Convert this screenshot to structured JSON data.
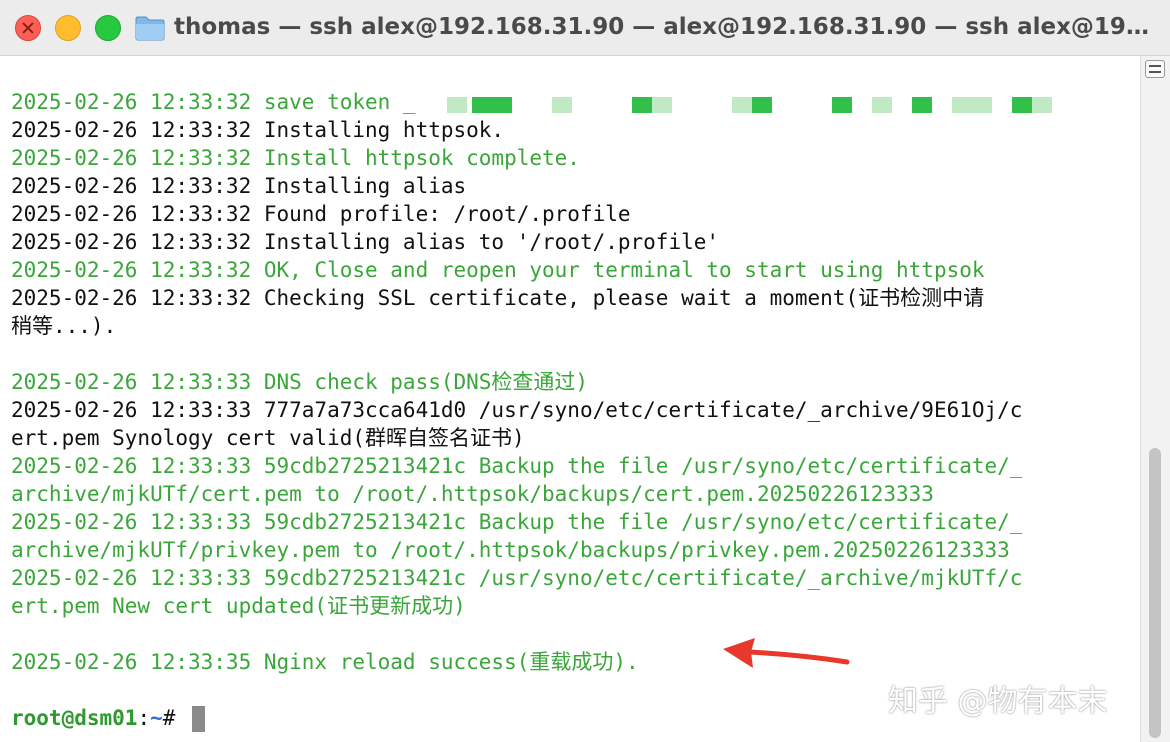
{
  "window": {
    "title": "thomas — ssh alex@192.168.31.90 — alex@192.168.31.90 — ssh alex@192.1..."
  },
  "terminal": {
    "lines": [
      {
        "text": "2025-02-26 12:33:32 save token _",
        "color": "green"
      },
      {
        "text": "2025-02-26 12:33:32 Installing httpsok.",
        "color": "black"
      },
      {
        "text": "2025-02-26 12:33:32 Install httpsok complete.",
        "color": "green"
      },
      {
        "text": "2025-02-26 12:33:32 Installing alias",
        "color": "black"
      },
      {
        "text": "2025-02-26 12:33:32 Found profile: /root/.profile",
        "color": "black"
      },
      {
        "text": "2025-02-26 12:33:32 Installing alias to '/root/.profile'",
        "color": "black"
      },
      {
        "text": "2025-02-26 12:33:32 OK, Close and reopen your terminal to start using httpsok",
        "color": "green"
      },
      {
        "text": "2025-02-26 12:33:32 Checking SSL certificate, please wait a moment(证书检测中请",
        "color": "black"
      },
      {
        "text": "稍等...).",
        "color": "black"
      },
      {
        "text": "",
        "color": "black"
      },
      {
        "text": "2025-02-26 12:33:33 DNS check pass(DNS检查通过)",
        "color": "green"
      },
      {
        "text": "2025-02-26 12:33:33 777a7a73cca641d0 /usr/syno/etc/certificate/_archive/9E61Oj/c",
        "color": "black"
      },
      {
        "text": "ert.pem Synology cert valid(群晖自签名证书)",
        "color": "black"
      },
      {
        "text": "2025-02-26 12:33:33 59cdb2725213421c Backup the file /usr/syno/etc/certificate/_",
        "color": "green"
      },
      {
        "text": "archive/mjkUTf/cert.pem to /root/.httpsok/backups/cert.pem.20250226123333",
        "color": "green"
      },
      {
        "text": "2025-02-26 12:33:33 59cdb2725213421c Backup the file /usr/syno/etc/certificate/_",
        "color": "green"
      },
      {
        "text": "archive/mjkUTf/privkey.pem to /root/.httpsok/backups/privkey.pem.20250226123333",
        "color": "green"
      },
      {
        "text": "2025-02-26 12:33:33 59cdb2725213421c /usr/syno/etc/certificate/_archive/mjkUTf/c",
        "color": "green"
      },
      {
        "text": "ert.pem New cert updated(证书更新成功)",
        "color": "green"
      },
      {
        "text": "",
        "color": "black"
      },
      {
        "text": "2025-02-26 12:33:35 Nginx reload success(重载成功).",
        "color": "green"
      },
      {
        "text": "",
        "color": "black"
      }
    ],
    "prompt": {
      "user_host": "root@dsm01",
      "separator": ":",
      "path": "~",
      "symbol": "#"
    }
  },
  "watermark": "知乎 @物有本末",
  "colors": {
    "green_text": "#3aa63a",
    "prompt_path": "#2f6fd6",
    "arrow": "#e8382c"
  },
  "icons": {
    "folder": "folder-icon",
    "scroll": "split-pane-icon",
    "annotation": "red-arrow-icon"
  }
}
